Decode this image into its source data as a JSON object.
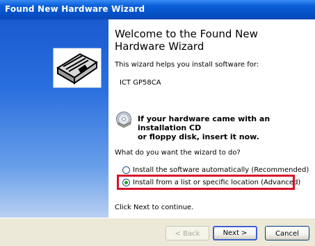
{
  "window": {
    "title": "Found New Hardware Wizard"
  },
  "icons": {
    "wizard": "hardware-wizard-icon",
    "cd": "cd-install-icon"
  },
  "content": {
    "heading_line1": "Welcome to the Found New",
    "heading_line2": "Hardware Wizard",
    "intro": "This wizard helps you install software for:",
    "device_name": "ICT GP58CA",
    "cd_notice_line1": "If your hardware came with an installation CD",
    "cd_notice_line2": "or floppy disk, insert it now.",
    "question": "What do you want the wizard to do?",
    "options": [
      {
        "label": "Install the software automatically (Recommended)",
        "selected": false
      },
      {
        "label": "Install from a list or specific location (Advanced)",
        "selected": true
      }
    ],
    "footer_hint": "Click Next to continue."
  },
  "buttons": {
    "back": "< Back",
    "next": "Next >",
    "cancel": "Cancel"
  },
  "colors": {
    "title_bar": "#0a5fd8",
    "highlight_box": "#d8102a",
    "button_bar": "#ece9d8"
  }
}
